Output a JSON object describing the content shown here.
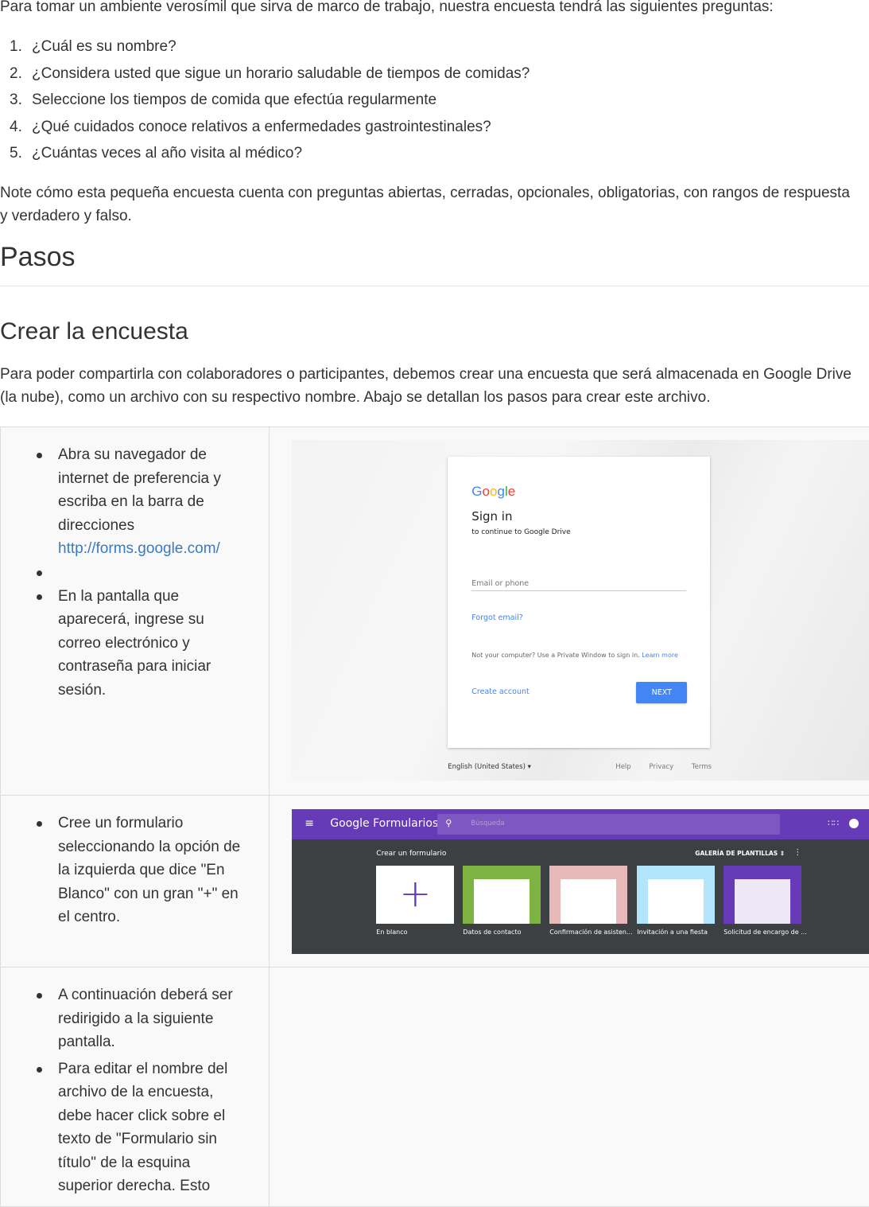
{
  "intro": "Para tomar un ambiente verosímil que sirva de marco de trabajo, nuestra encuesta tendrá las siguientes preguntas:",
  "questions": [
    {
      "num": "1.",
      "text": "¿Cuál es su nombre?"
    },
    {
      "num": "2.",
      "text": "¿Considera usted que sigue un horario saludable de tiempos de comidas?"
    },
    {
      "num": "3.",
      "text": "Seleccione los tiempos de comida que efectúa regularmente"
    },
    {
      "num": "4.",
      "text": "¿Qué cuidados conoce relativos a enfermedades gastrointestinales?"
    },
    {
      "num": "5.",
      "text": "¿Cuántas veces al año visita al médico?"
    }
  ],
  "note": "Note cómo esta pequeña encuesta cuenta con preguntas abiertas, cerradas, opcionales, obligatorias, con rangos de respuesta y verdadero y falso.",
  "heading_pasos": "Pasos",
  "heading_crear": "Crear la encuesta",
  "crear_paragraph": "Para poder compartirla con colaboradores o participantes, debemos crear una encuesta que será almacenada en Google Drive (la nube), como un archivo con su respectivo nombre. Abajo se detallan los pasos para crear este archivo.",
  "steps": {
    "row1": {
      "b1_text": "Abra su navegador de internet de preferencia y escriba en la barra de direcciones",
      "b1_link": "http://forms.google.com/",
      "b2_text": "En la pantalla que aparecerá, ingrese su correo electrónico y contraseña para iniciar sesión."
    },
    "row2": {
      "b1_text": "Cree un formulario seleccionando la opción de la izquierda que dice \"En Blanco\" con un gran \"+\" en el centro."
    },
    "row3": {
      "b1_text": "A continuación deberá ser redirigido a la siguiente pantalla.",
      "b2_text": "Para editar el nombre del archivo de la encuesta, debe hacer click sobre el texto de \"Formulario sin título\" de la esquina superior derecha. Esto"
    }
  },
  "signin": {
    "logo": "Google",
    "title": "Sign in",
    "subtitle": "to continue to Google Drive",
    "email_placeholder": "Email or phone",
    "forgot": "Forgot email?",
    "not_your_computer": "Not your computer? Use a Private Window to sign in.",
    "learn_more": "Learn more",
    "create_account": "Create account",
    "next": "NEXT",
    "language": "English (United States)",
    "footer_links": [
      "Help",
      "Privacy",
      "Terms"
    ]
  },
  "forms": {
    "brand_google": "Google",
    "brand_product": "Formularios",
    "search_placeholder": "Búsqueda",
    "crear_label": "Crear un formulario",
    "galeria": "GALERÍA DE PLANTILLAS",
    "templates": [
      {
        "label": "En blanco",
        "color": "#ffffff"
      },
      {
        "label": "Datos de contacto",
        "color": "#7cb342"
      },
      {
        "label": "Confirmación de asisten...",
        "color": "#e6b8b8"
      },
      {
        "label": "Invitación a una fiesta",
        "color": "#b3e5fc"
      },
      {
        "label": "Solicitud de encargo de ...",
        "color": "#673ab7"
      }
    ]
  },
  "colors": {
    "link": "#3a7bc0",
    "google_blue": "#4285f4",
    "forms_purple": "#673ab7"
  }
}
